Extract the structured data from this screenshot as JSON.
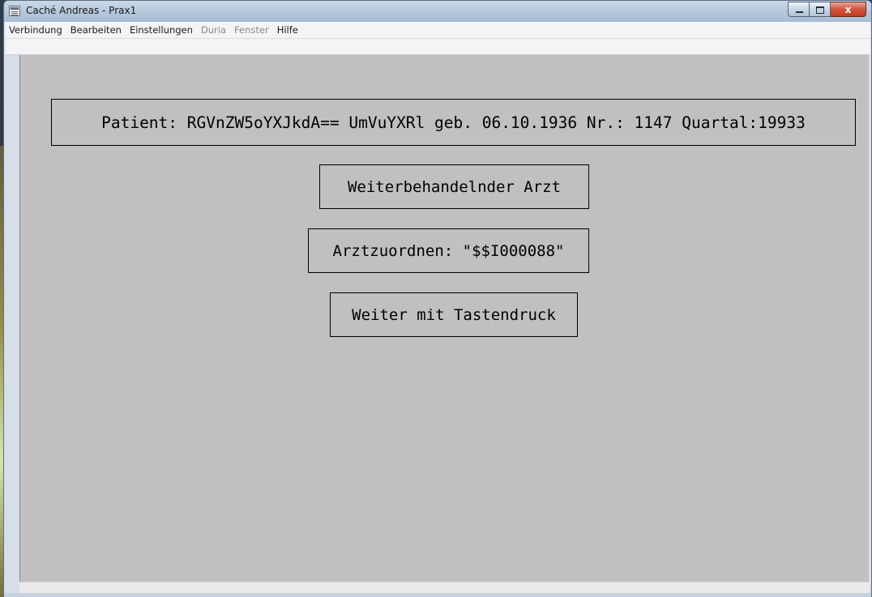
{
  "window": {
    "title": "Caché Andreas - Prax1",
    "controls": {
      "minimize_icon": "minimize-icon",
      "maximize_icon": "maximize-icon",
      "close_icon": "close-icon",
      "close_glyph": "x"
    }
  },
  "menubar": {
    "items": [
      {
        "label": "Verbindung",
        "enabled": true
      },
      {
        "label": "Bearbeiten",
        "enabled": true
      },
      {
        "label": "Einstellungen",
        "enabled": true
      },
      {
        "label": "Duria",
        "enabled": false
      },
      {
        "label": "Fenster",
        "enabled": false
      },
      {
        "label": "Hilfe",
        "enabled": true
      }
    ]
  },
  "terminal": {
    "patient_line": "Patient: RGVnZW5oYXJkdA== UmVuYXRl geb. 06.10.1936 Nr.: 1147 Quartal:19933",
    "heading": "Weiterbehandelnder Arzt",
    "assign_line": "Arztzuordnen: \"$$I000088\"",
    "continue_prompt": "Weiter mit Tastendruck"
  },
  "colors": {
    "terminal_background": "#c0c0c0",
    "text": "#000000",
    "close_button": "#c94a30"
  }
}
